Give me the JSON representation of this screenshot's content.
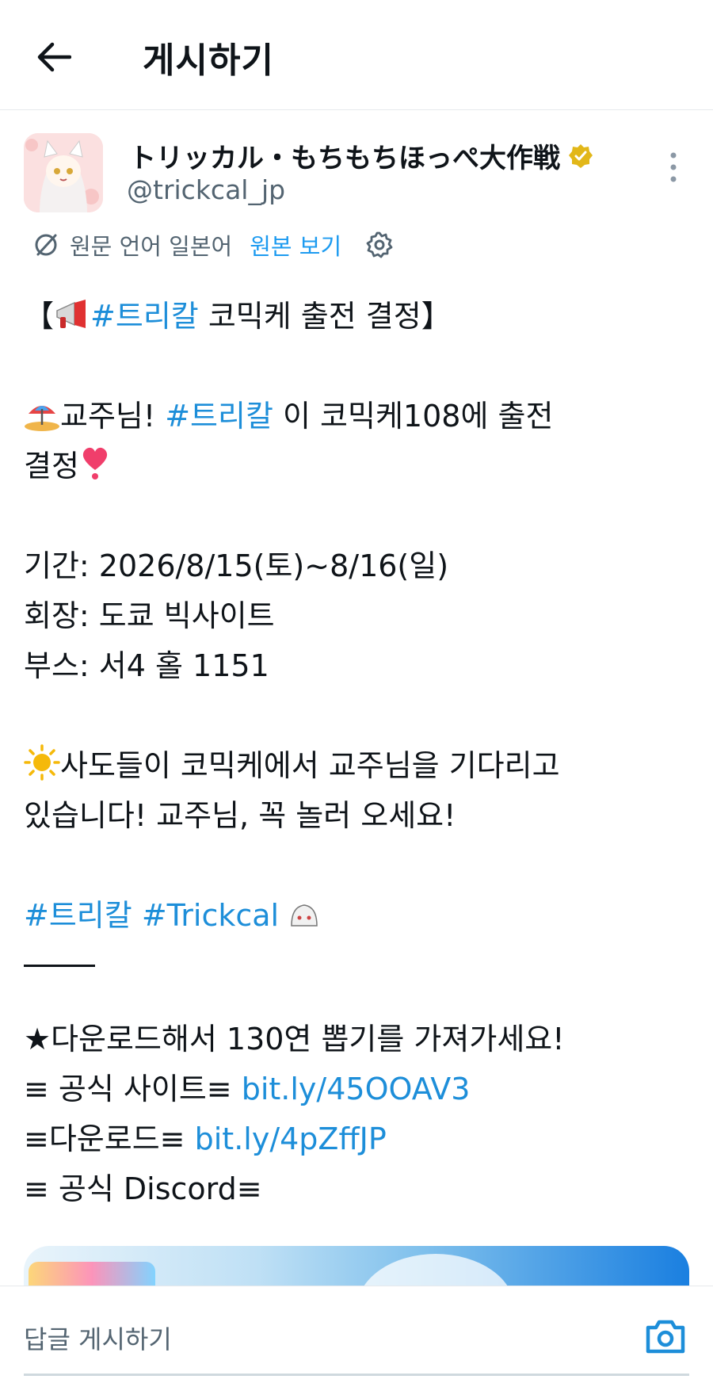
{
  "header": {
    "title": "게시하기"
  },
  "author": {
    "display_name": "トリッカル・もちもちほっぺ大作戦",
    "handle": "@trickcal_jp",
    "verified_color": "#e2b719"
  },
  "translation": {
    "original_language": "원문 언어 일본어",
    "show_original": "원본 보기"
  },
  "post": {
    "l1": {
      "open": "【",
      "tag": "#트리칼",
      "rest": " 코믹케 출전 결정】"
    },
    "l2": {
      "pre": "교주님! ",
      "tag": "#트리칼",
      "rest": " 이 코믹케108에 출전"
    },
    "l3": {
      "text": "결정"
    },
    "l4": "기간: 2026/8/15(토)~8/16(일)",
    "l5": "회장: 도쿄 빅사이트",
    "l6": "부스: 서4 홀 1151",
    "l7": "사도들이 코믹케에서 교주님을 기다리고",
    "l8": "있습니다! 교주님, 꼭 놀러 오세요!",
    "l9": {
      "tag1": "#트리칼",
      "tag2": "#Trickcal"
    },
    "l10": "★다운로드해서 130연 뽑기를 가져가세요!",
    "l11": {
      "label": "≡ 공식 사이트≡ ",
      "link": "bit.ly/45OOAV3"
    },
    "l12": {
      "label": "≡다운로드≡ ",
      "link": "bit.ly/4pZffJP"
    },
    "l13": "≡ 공식 Discord≡"
  },
  "reply": {
    "placeholder": "답글 게시하기"
  },
  "colors": {
    "link": "#1d8ed9",
    "muted": "#536471",
    "text": "#0f1419"
  }
}
